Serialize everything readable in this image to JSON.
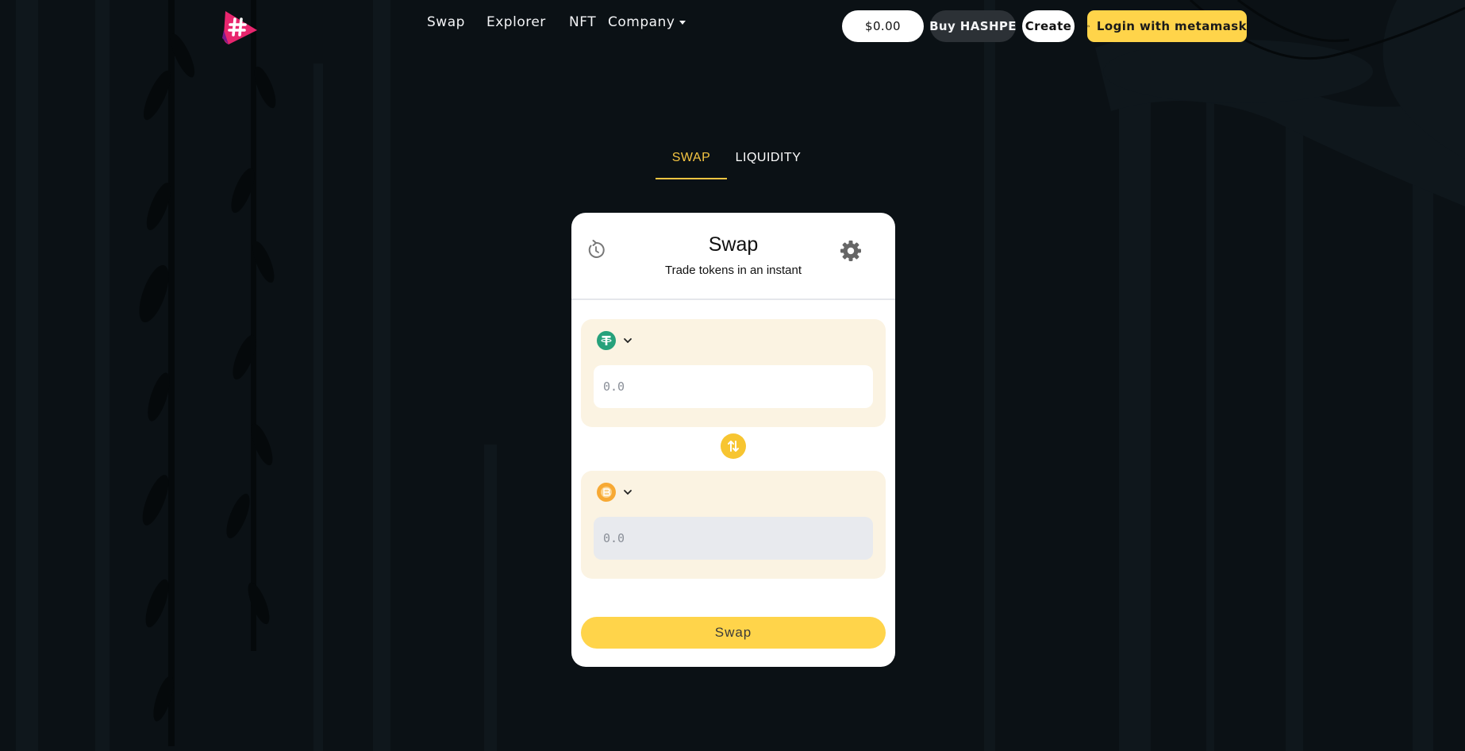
{
  "header": {
    "nav": [
      {
        "label": "Swap"
      },
      {
        "label": "Explorer"
      },
      {
        "label": "NFT"
      },
      {
        "label": "Company"
      }
    ],
    "balance": "$0.00",
    "buy_label": "Buy HASHPE",
    "create_label": "Create",
    "login_label": "Login with metamask"
  },
  "tabs": [
    {
      "label": "SWAP",
      "active": true
    },
    {
      "label": "LIQUIDITY",
      "active": false
    }
  ],
  "swap_card": {
    "title": "Swap",
    "subtitle": "Trade tokens in an instant",
    "from": {
      "token_icon": "tether-icon",
      "placeholder": "0.0"
    },
    "to": {
      "token_icon": "coin-icon",
      "placeholder": "0.0"
    },
    "action_label": "Swap"
  },
  "colors": {
    "background": "#0b1115",
    "accent": "#ffd44a",
    "logo": "#e8266e",
    "tether": "#26a17b",
    "panel": "#fbf3e2"
  }
}
